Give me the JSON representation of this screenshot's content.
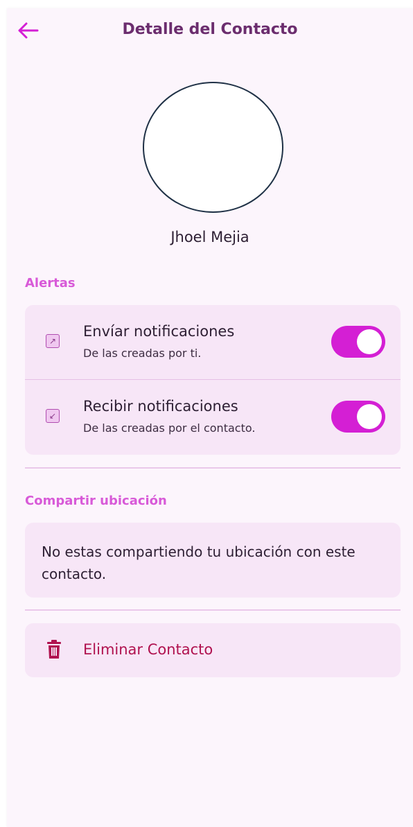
{
  "header": {
    "title": "Detalle del Contacto",
    "back_icon": "arrow-left-icon"
  },
  "contact": {
    "name": "Jhoel Mejia"
  },
  "alerts": {
    "section_title": "Alertas",
    "items": [
      {
        "icon": "arrow-up-right-icon",
        "title": "Envíar notificaciones",
        "subtitle": "De las creadas por ti.",
        "enabled": true
      },
      {
        "icon": "arrow-down-left-icon",
        "title": "Recibir notificaciones",
        "subtitle": "De las creadas por el contacto.",
        "enabled": true
      }
    ]
  },
  "location": {
    "section_title": "Compartir ubicación",
    "message": "No estas compartiendo tu ubicación con este contacto."
  },
  "actions": {
    "delete_label": "Eliminar Contacto",
    "delete_icon": "trash-icon"
  },
  "colors": {
    "accent": "#d41fd4",
    "section_title": "#d85ad8",
    "card_bg": "#f7e6f7",
    "danger": "#b0124f",
    "header_title": "#6b2d6e"
  }
}
